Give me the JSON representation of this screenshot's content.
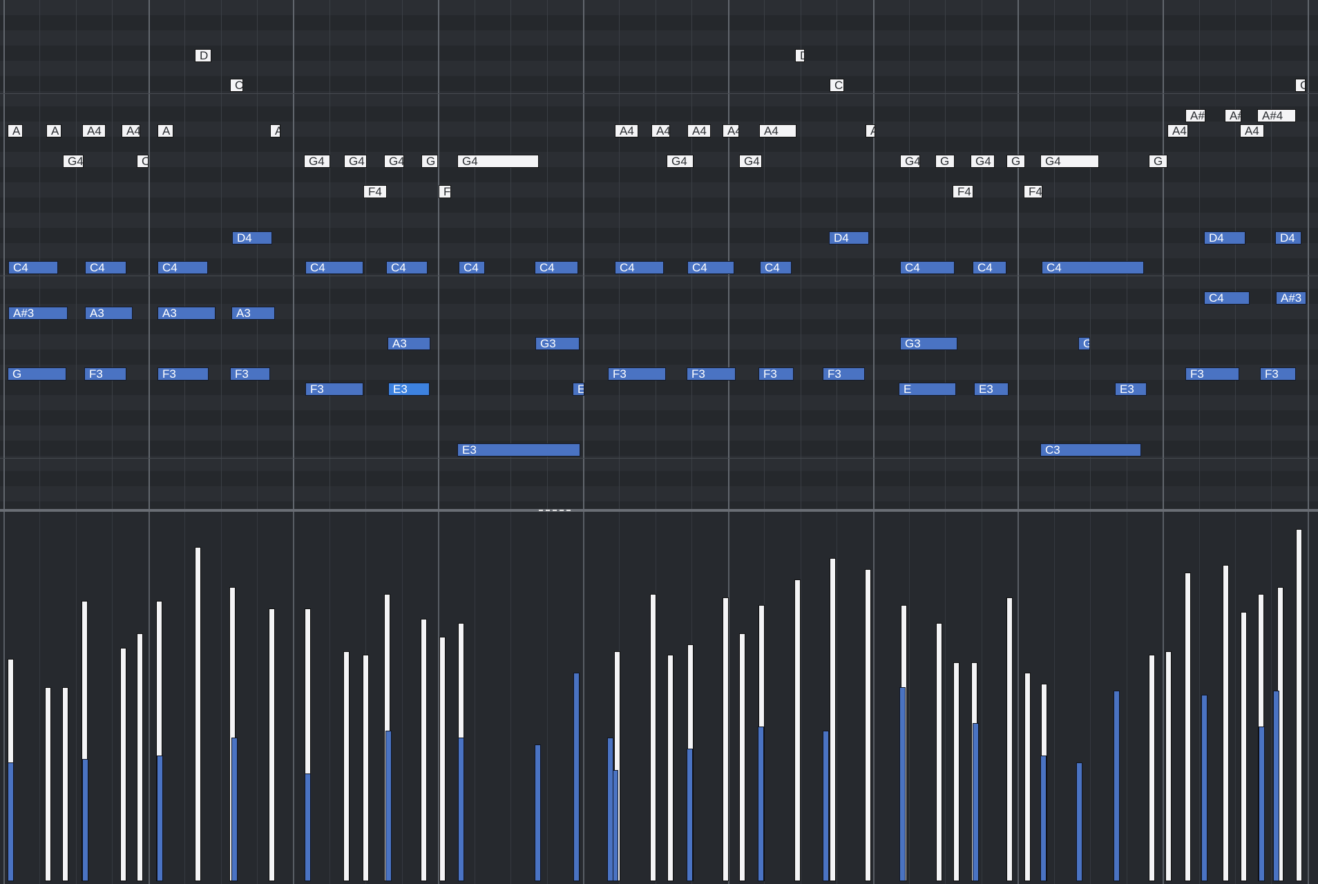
{
  "colors": {
    "background": "#26292e",
    "note_white": "#f4f4f6",
    "note_blue": "#4a73c3",
    "note_selected": "#3d82e0",
    "grid_bar": "#62676e"
  },
  "editor": {
    "notes": [
      "A",
      "A",
      "A4",
      "A4",
      "A",
      "A",
      "A4",
      "A4",
      "A4",
      "A4",
      "A4",
      "A",
      "A#",
      "A#",
      "A#4",
      "A4",
      "A4",
      "D",
      "D",
      "C",
      "C",
      "C",
      "G4",
      "C",
      "G4",
      "G4",
      "G4",
      "G",
      "G4",
      "G4",
      "G4",
      "G4",
      "G",
      "G4",
      "G",
      "G4",
      "G",
      "F4",
      "F",
      "F4",
      "F4",
      "D4",
      "D4",
      "D4",
      "D4",
      "C4",
      "C4",
      "C4",
      "C4",
      "C4",
      "C4",
      "C4",
      "C4",
      "C4",
      "C4",
      "C4",
      "C4",
      "C4",
      "C4",
      "A#3",
      "A#3",
      "A3",
      "A3",
      "A3",
      "A3",
      "G3",
      "G3",
      "G3",
      "G",
      "F3",
      "F3",
      "F3",
      "F3",
      "F3",
      "F3",
      "F3",
      "F3",
      "F3",
      "F3",
      "E3",
      "E3",
      "E",
      "E3",
      "E3",
      "E3",
      "C3",
      "C3"
    ]
  },
  "velocity_lane": {
    "white_levels": [
      0.62,
      0.54,
      0.54,
      0.78,
      0.65,
      0.69,
      0.78,
      0.93,
      0.82,
      0.76,
      0.76,
      0.64,
      0.63,
      0.8,
      0.73,
      0.68,
      0.72,
      0.64,
      0.8,
      0.63,
      0.66,
      0.79,
      0.69,
      0.77,
      0.84,
      0.9,
      0.87,
      0.77,
      0.72,
      0.61,
      0.61,
      0.79,
      0.58,
      0.55,
      0.63,
      0.64,
      0.86,
      0.88,
      0.75,
      0.8,
      0.82,
      0.98
    ],
    "blue_levels": [
      0.33,
      0.34,
      0.35,
      0.4,
      0.3,
      0.42,
      0.4,
      0.38,
      0.58,
      0.31,
      0.37,
      0.43,
      0.42,
      0.54,
      0.44,
      0.35,
      0.33,
      0.53,
      0.52,
      0.43,
      0.53,
      0.4
    ]
  }
}
